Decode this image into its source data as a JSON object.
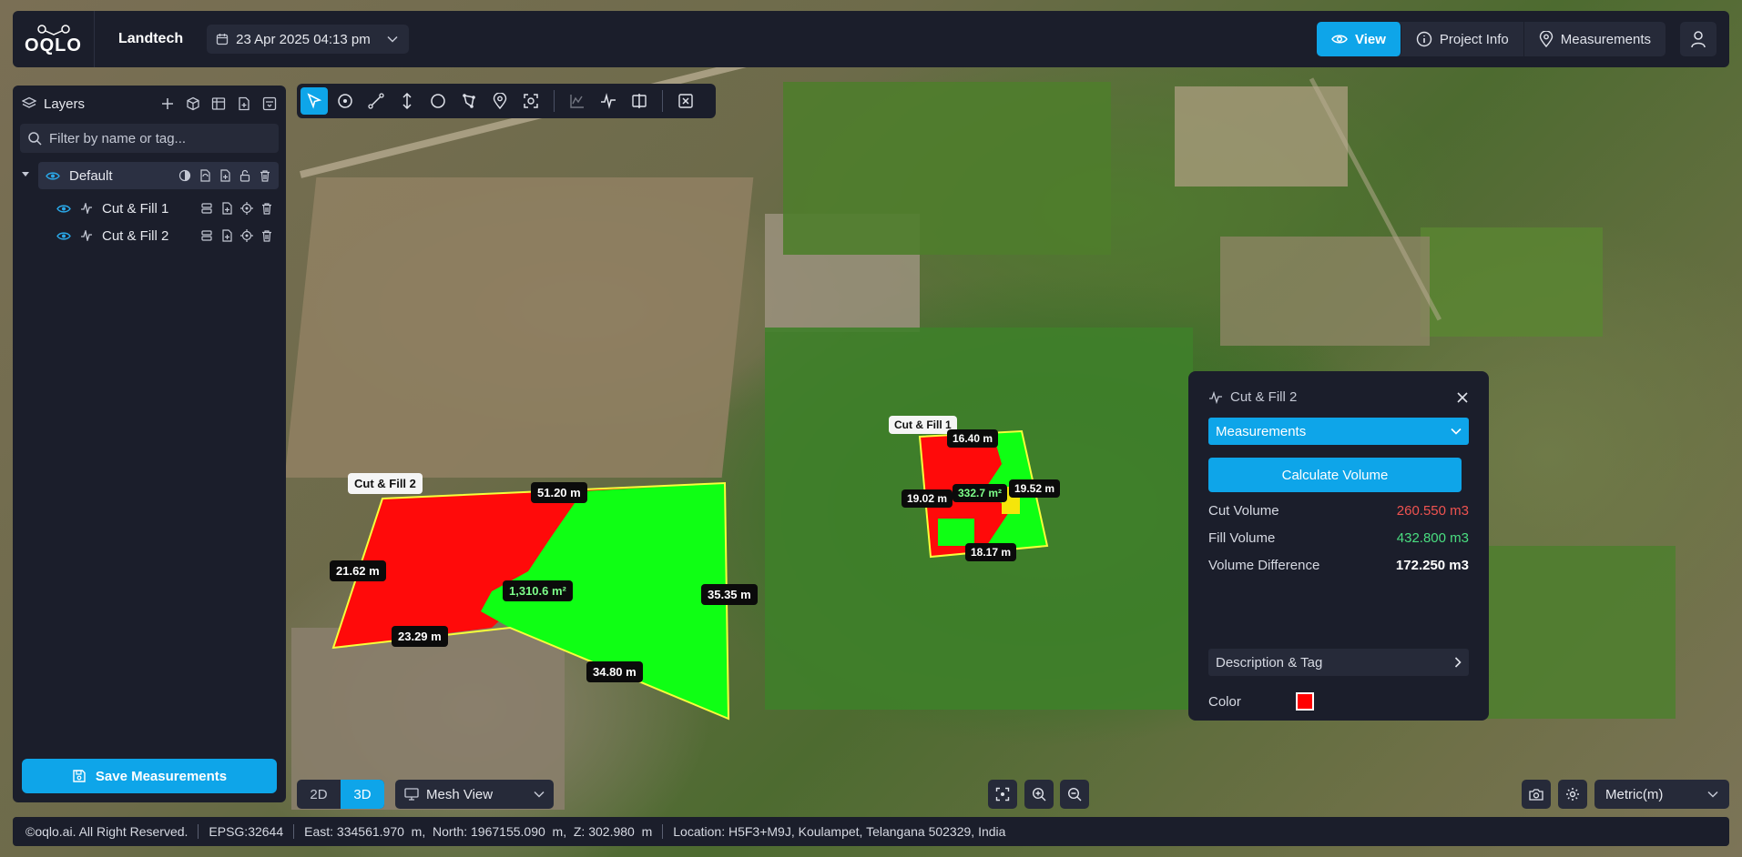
{
  "app": {
    "logo_text": "OQLO",
    "org_name": "Landtech",
    "date": "23 Apr 2025 04:13 pm"
  },
  "nav": {
    "tabs": [
      {
        "label": "View",
        "icon": "eye-icon",
        "active": true
      },
      {
        "label": "Project Info",
        "icon": "info-icon",
        "active": false
      },
      {
        "label": "Measurements",
        "icon": "map-pin-icon",
        "active": false
      }
    ]
  },
  "layers": {
    "title": "Layers",
    "filter_placeholder": "Filter by name or tag...",
    "group": {
      "label": "Default"
    },
    "items": [
      {
        "label": "Cut & Fill 1"
      },
      {
        "label": "Cut & Fill 2"
      }
    ],
    "save_label": "Save Measurements"
  },
  "map_labels": {
    "cf2_name": "Cut & Fill 2",
    "cf2_top": "51.20 m",
    "cf2_left": "21.62 m",
    "cf2_area": "1,310.6 m²",
    "cf2_right": "35.35 m",
    "cf2_bottom_left": "23.29 m",
    "cf2_bottom": "34.80 m",
    "cf1_name": "Cut & Fill 1",
    "cf1_top": "16.40 m",
    "cf1_left": "19.02 m",
    "cf1_area": "332.7 m²",
    "cf1_right": "19.52 m",
    "cf1_bottom": "18.17 m"
  },
  "info_panel": {
    "title": "Cut & Fill 2",
    "select_label": "Measurements",
    "calc_label": "Calculate Volume",
    "rows": [
      {
        "label": "Cut Volume",
        "value": "260.550 m3"
      },
      {
        "label": "Fill Volume",
        "value": "432.800 m3"
      },
      {
        "label": "Volume Difference",
        "value": "172.250 m3"
      }
    ],
    "desc_label": "Description & Tag",
    "color_label": "Color",
    "color": "#ff0000"
  },
  "bottom": {
    "dim_2d": "2D",
    "dim_3d": "3D",
    "view_mode": "Mesh View",
    "units": "Metric(m)"
  },
  "status": {
    "copyright": "©oqlo.ai. All Right Reserved.",
    "epsg": "EPSG:32644",
    "coords": "East: 334561.970  m,  North: 1967155.090  m,  Z: 302.980  m",
    "location": "Location: H5F3+M9J, Koulampet, Telangana 502329, India"
  },
  "colors": {
    "accent": "#0ea5e9",
    "panel": "#1b1e2b",
    "cut": "#ef5350",
    "fill": "#4ade80"
  }
}
